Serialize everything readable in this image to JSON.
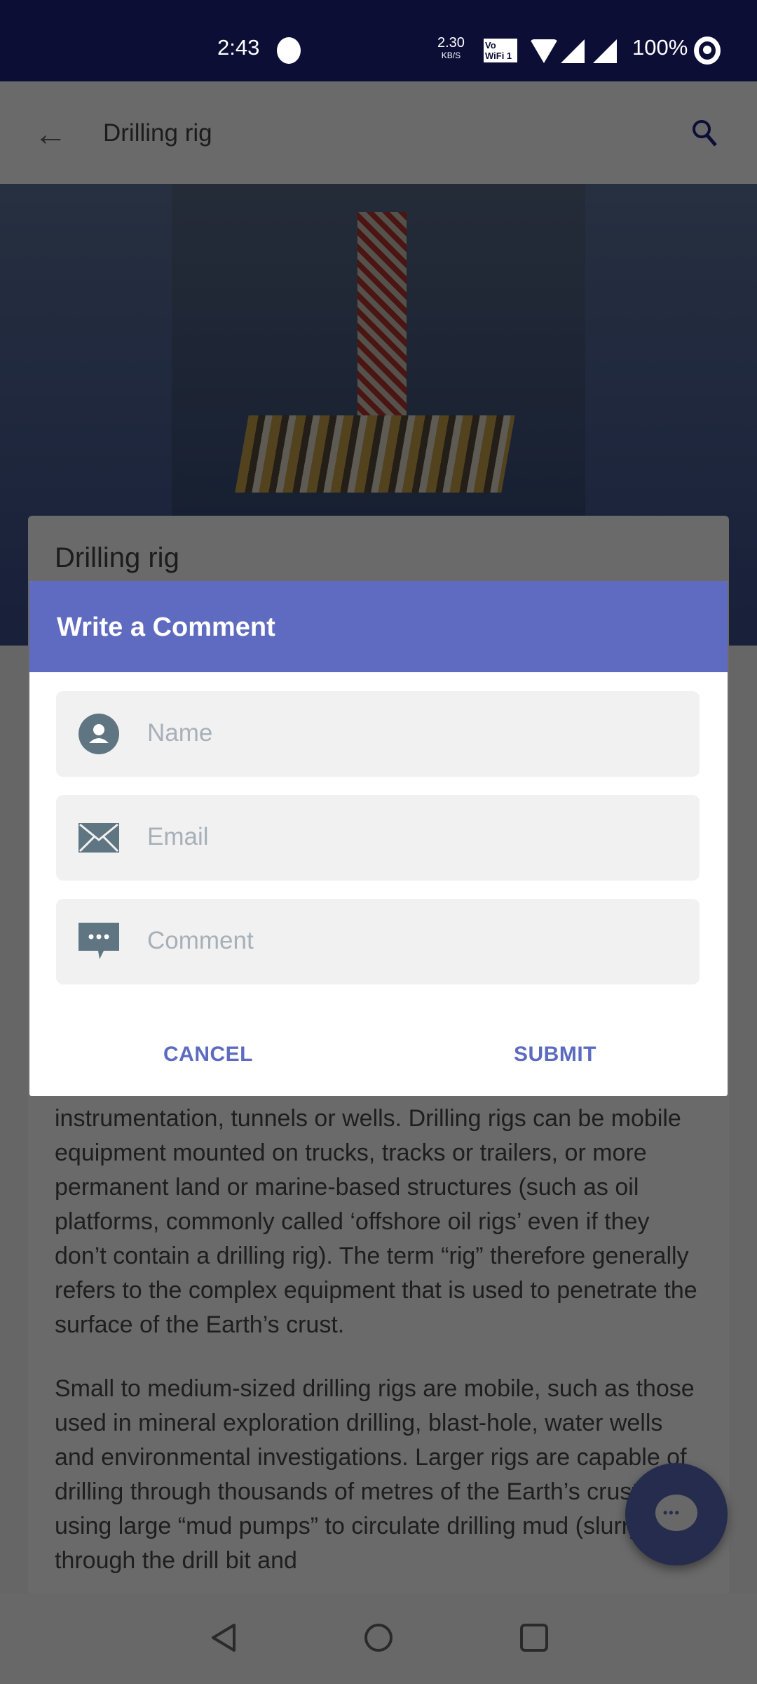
{
  "status_bar": {
    "time": "2:43",
    "net_speed": "2.30",
    "net_unit": "KB/S",
    "vowifi": "Vo WiFi 1",
    "battery": "100%"
  },
  "app_bar": {
    "title": "Drilling rig",
    "back_icon": "arrow-back-icon",
    "search_icon": "search-icon"
  },
  "card": {
    "title": "Drilling rig"
  },
  "article": {
    "paragraphs": [
      "instrumentation, tunnels or wells. Drilling rigs can be mobile equipment mounted on trucks, tracks or trailers, or more permanent land or marine-based structures (such as oil platforms, commonly called ‘offshore oil rigs’ even if they don’t contain a drilling rig). The term “rig” therefore generally refers to the complex equipment that is used to penetrate the surface of the Earth’s crust.",
      "Small to medium-sized drilling rigs are mobile, such as those used in mineral exploration drilling, blast-hole, water wells and environmental investigations. Larger rigs are capable of drilling through thousands of metres of the Earth’s crust, using large “mud pumps” to circulate drilling mud (slurry) through the drill bit and"
    ]
  },
  "dialog": {
    "title": "Write a Comment",
    "fields": [
      {
        "placeholder": "Name",
        "icon": "person-icon"
      },
      {
        "placeholder": "Email",
        "icon": "mail-icon"
      },
      {
        "placeholder": "Comment",
        "icon": "comment-icon"
      }
    ],
    "cancel_label": "CANCEL",
    "submit_label": "SUBMIT"
  },
  "colors": {
    "accent": "#5f6bc0",
    "status_bar": "#0c0e36",
    "icon": "#5f7582"
  }
}
